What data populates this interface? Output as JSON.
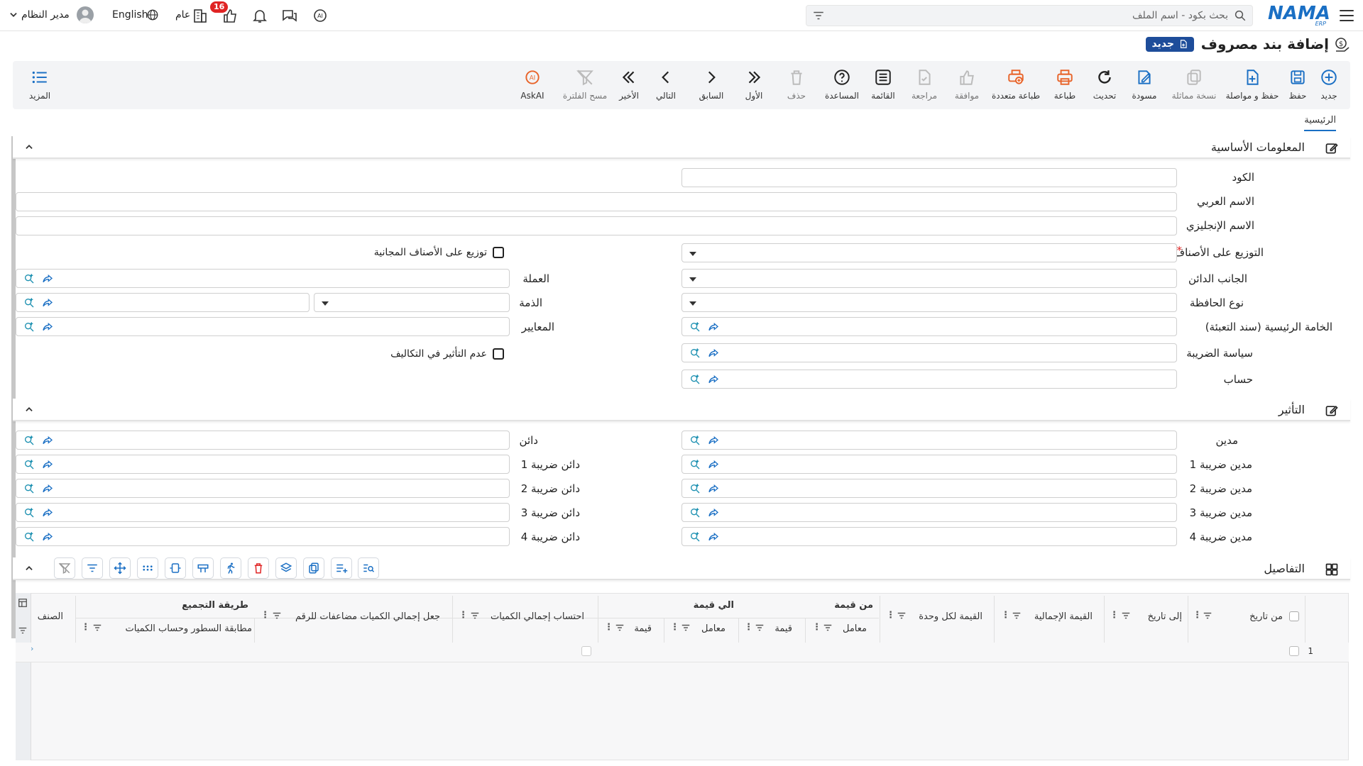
{
  "topbar": {
    "search_placeholder": "بحث بكود - اسم الملف",
    "language_label": "English",
    "user_label": "مدير النظام",
    "branch_label": "عام",
    "notification_count": "16",
    "logo_text": "NAMA",
    "logo_sub": "ERP",
    "icons": [
      "menu-icon",
      "search-icon",
      "filter-icon",
      "ai-icon",
      "chat-icon",
      "bell-icon",
      "approval-icon",
      "building-icon",
      "globe-icon",
      "user-icon",
      "chevron-down-icon"
    ]
  },
  "title": {
    "text": "إضافة بند مصروف",
    "new_badge": "جديد"
  },
  "toolbar": {
    "items": [
      {
        "label": "جديد",
        "icon": "plus-circle-icon"
      },
      {
        "label": "حفظ",
        "icon": "save-icon"
      },
      {
        "label": "حفظ و مواصلة",
        "icon": "save-continue-icon"
      },
      {
        "label": "نسخة مماثلة",
        "icon": "copy-icon"
      },
      {
        "label": "مسودة",
        "icon": "draft-icon"
      },
      {
        "label": "تحديث",
        "icon": "refresh-icon"
      },
      {
        "label": "طباعة",
        "icon": "print-icon"
      },
      {
        "label": "طباعة متعددة",
        "icon": "multi-print-icon"
      },
      {
        "label": "موافقة",
        "icon": "thumbs-up-icon"
      },
      {
        "label": "مراجعة",
        "icon": "review-icon"
      },
      {
        "label": "القائمة",
        "icon": "list-icon"
      },
      {
        "label": "المساعدة",
        "icon": "help-icon"
      },
      {
        "label": "حذف",
        "icon": "trash-icon"
      },
      {
        "label": "الأول",
        "icon": "first-icon"
      },
      {
        "label": "السابق",
        "icon": "prev-icon"
      },
      {
        "label": "التالي",
        "icon": "next-icon"
      },
      {
        "label": "الأخير",
        "icon": "last-icon"
      },
      {
        "label": "مسح الفلترة",
        "icon": "clear-filter-icon"
      },
      {
        "label": "AskAI",
        "icon": "askai-icon"
      }
    ],
    "more_label": "المزيد"
  },
  "tabs": {
    "main": "الرئيسية"
  },
  "basic_section": {
    "title": "المعلومات الأساسية",
    "code": "الكود",
    "arabic_name": "الاسم العربي",
    "english_name": "الاسم الإنجليزي",
    "distribution": "التوزيع على الأصناف",
    "required_mark": "*",
    "distribute_free": "توزيع على الأصناف المجانية",
    "credit_side": "الجانب الدائن",
    "currency": "العملة",
    "wallet_type": "نوع الحافظة",
    "liability": "الذمة",
    "main_material": "الخامة الرئيسية (سند التعبئة)",
    "criteria": "المعايير",
    "tax_policy": "سياسة الضريبة",
    "no_cost_effect": "عدم التأثير في التكاليف",
    "account": "حساب"
  },
  "effect_section": {
    "title": "التأثير",
    "debit": "مدين",
    "credit": "دائن",
    "debit_tax1": "مدين ضريبة 1",
    "credit_tax1": "دائن ضريبة 1",
    "debit_tax2": "مدين ضريبة 2",
    "credit_tax2": "دائن ضريبة 2",
    "debit_tax3": "مدين ضريبة 3",
    "credit_tax3": "دائن ضريبة 3",
    "debit_tax4": "مدين ضريبة 4",
    "credit_tax4": "دائن ضريبة 4"
  },
  "details_section": {
    "title": "التفاصيل",
    "columns": {
      "from_date": "من تاريخ",
      "to_date": "إلى تاريخ",
      "total_value": "القيمة الإجمالية",
      "value_per_unit": "القيمة لكل وحدة",
      "from_value": "من قيمة",
      "to_value": "الي قيمة",
      "factor": "معامل",
      "value": "قيمة",
      "calc_total_qty": "احتساب إجمالي الكميات",
      "total_qty_multiple": "جعل إجمالي الكميات مضاعفات للرقم",
      "grouping_method": "طريقة التجميع",
      "match_lines": "مطابقة السطور وحساب الكميات",
      "item": "الصنف"
    },
    "rows": [
      {
        "index": "1"
      }
    ]
  }
}
